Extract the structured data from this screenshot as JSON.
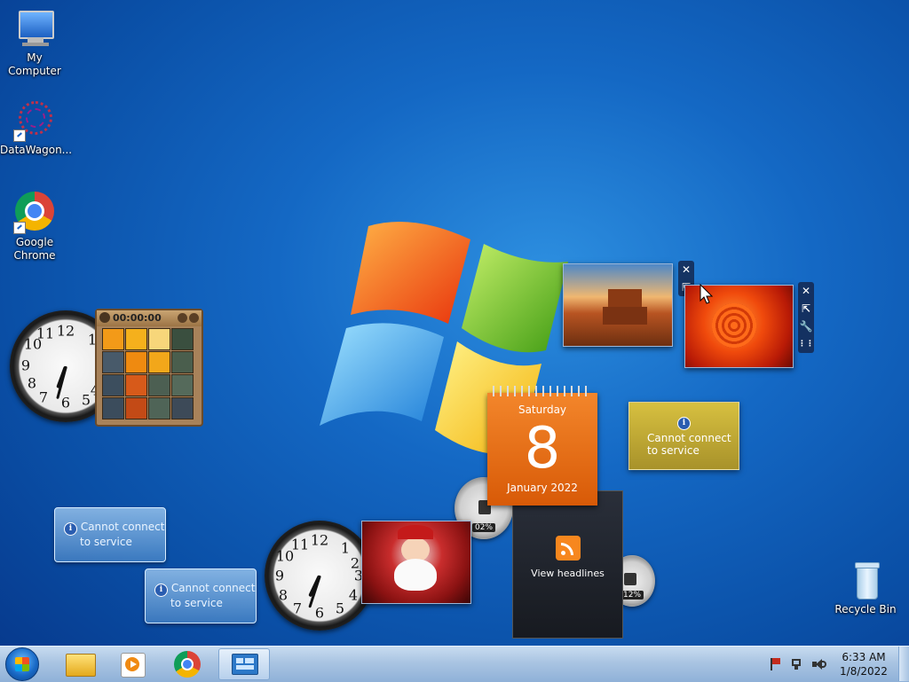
{
  "desktop": {
    "icons": [
      {
        "label": "My Computer"
      },
      {
        "label": "DataWagon..."
      },
      {
        "label": "Google Chrome"
      },
      {
        "label": "Recycle Bin"
      }
    ]
  },
  "gadgets": {
    "puzzle": {
      "timer": "00:00:00"
    },
    "calendar": {
      "weekday": "Saturday",
      "day": "8",
      "month_year": "January 2022"
    },
    "feed": {
      "label": "View headlines"
    },
    "meter_cpu": {
      "percent": "02%"
    },
    "meter_ram": {
      "percent": "12%"
    },
    "weather": {
      "line1": "Cannot connect",
      "line2": "to service"
    },
    "service1": {
      "line1": "Cannot connect",
      "line2": "to service"
    },
    "service2": {
      "line1": "Cannot connect",
      "line2": "to service"
    },
    "controls": {
      "close": "✕",
      "resize": "⇱",
      "options": "🔧"
    }
  },
  "clock_small_1": {
    "hour": 7,
    "minute": 33
  },
  "clock_small_2": {
    "hour": 7,
    "minute": 33
  },
  "taskbar": {
    "time": "6:33 AM",
    "date": "1/8/2022"
  },
  "colors": {
    "accent_orange": "#e86a12",
    "taskbar": "#a9c4e2",
    "desktop_blue": "#1468c4"
  }
}
